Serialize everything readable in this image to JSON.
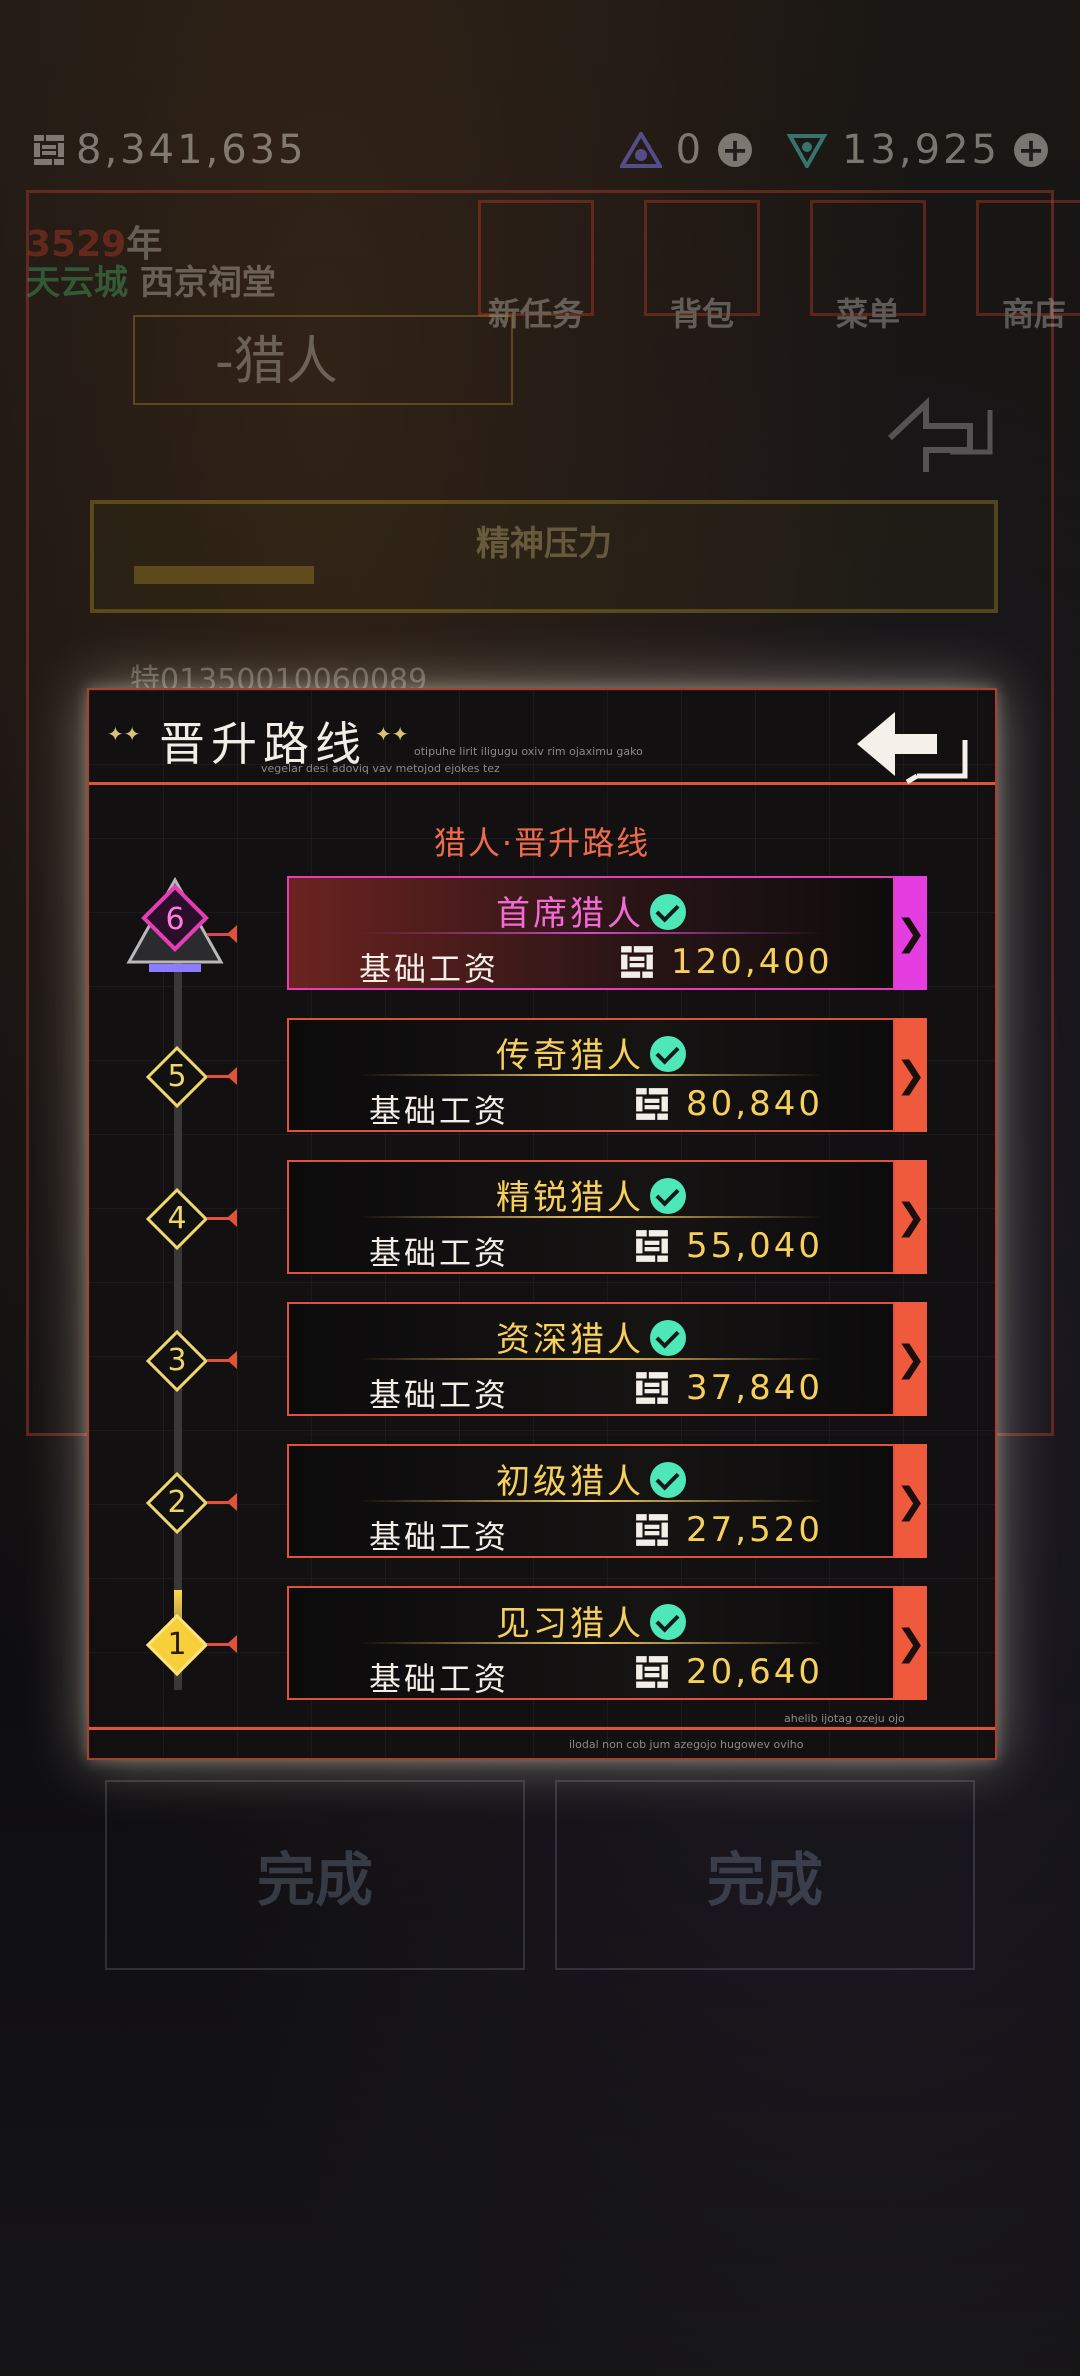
{
  "topbar": {
    "currency": "8,341,635",
    "gems": "0",
    "tokens": "13,925"
  },
  "background": {
    "year_num": "3529",
    "year_suffix": "年",
    "location_city": "天云城",
    "location_place": "西京祠堂",
    "menu": [
      "新任务",
      "背包",
      "菜单",
      "商店"
    ],
    "title": "-猎人",
    "stress_label": "精神压力",
    "hunter_id": "特01350010060089",
    "done_label": "完成"
  },
  "modal": {
    "title": "晋升路线",
    "subtitle": "猎人·晋升路线",
    "salary_label": "基础工资",
    "flavor_1": "otipuhe lirit iligugu oxiv rim ojaximu gako",
    "flavor_2": "vegelar desi adoviq vav metojod ejokes tez",
    "flavor_3": "ahelib ijotag ozeju ojo",
    "flavor_4": "ilodal non cob jum azegojo hugowev oviho"
  },
  "ranks": [
    {
      "level": "6",
      "name": "首席猎人",
      "salary": "120,400"
    },
    {
      "level": "5",
      "name": "传奇猎人",
      "salary": "80,840"
    },
    {
      "level": "4",
      "name": "精锐猎人",
      "salary": "55,040"
    },
    {
      "level": "3",
      "name": "资深猎人",
      "salary": "37,840"
    },
    {
      "level": "2",
      "name": "初级猎人",
      "salary": "27,520"
    },
    {
      "level": "1",
      "name": "见习猎人",
      "salary": "20,640"
    }
  ],
  "colors": {
    "accent": "#e0523a",
    "gold": "#f6d05b",
    "top_rank": "#e43db5",
    "check": "#4de7b8"
  }
}
